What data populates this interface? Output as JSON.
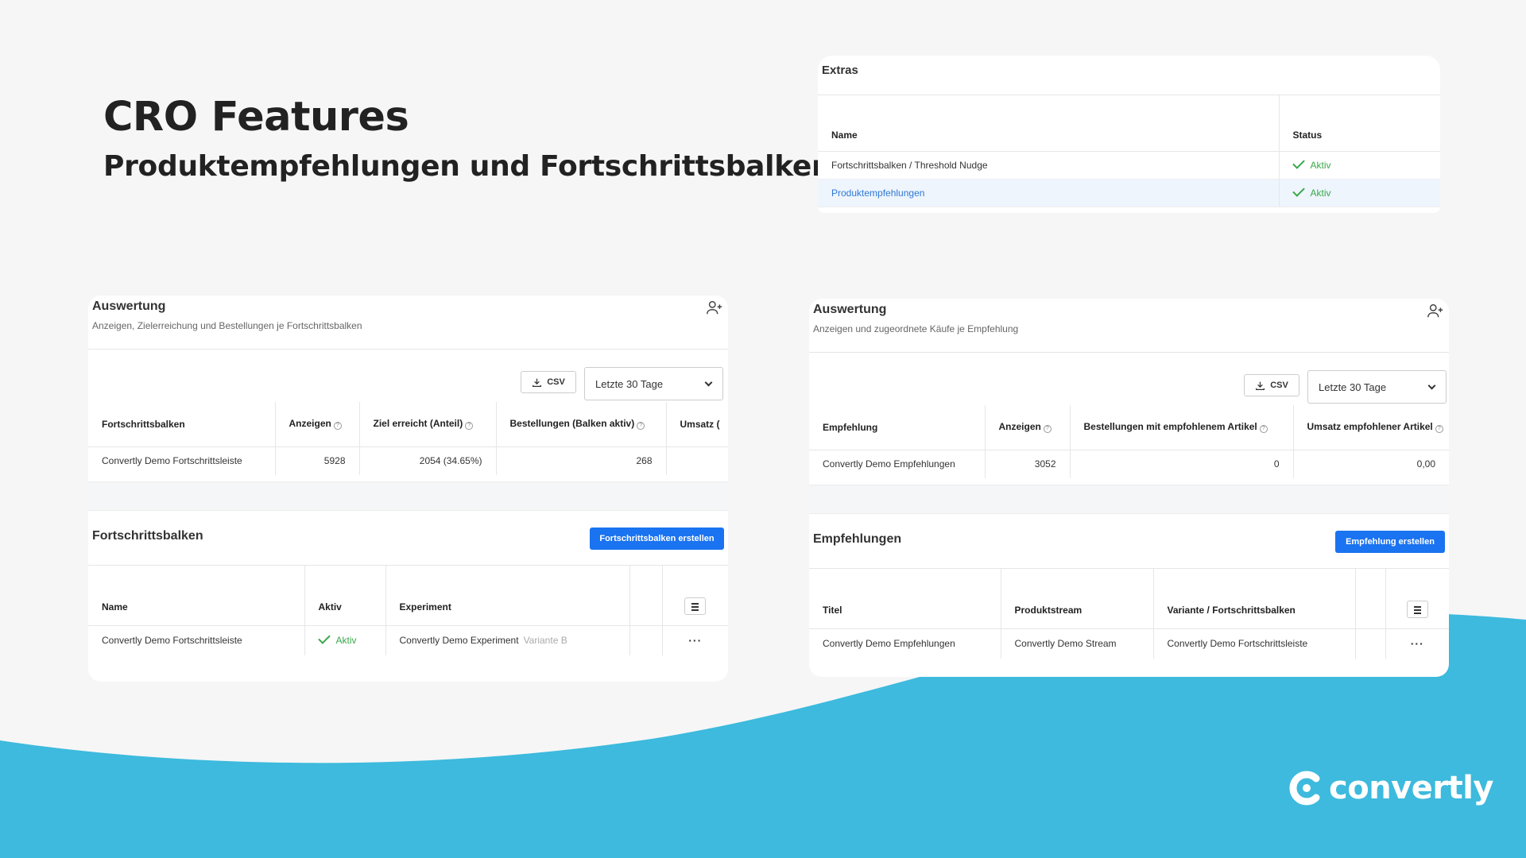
{
  "colors": {
    "accent": "#1a73f0",
    "wave": "#3dbadd",
    "status_active": "#39a84a"
  },
  "hero": {
    "title": "CRO Features",
    "subtitle": "Produktempfehlungen und Fortschrittsbalken"
  },
  "extras": {
    "title": "Extras",
    "columns": [
      "Name",
      "Status"
    ],
    "rows": [
      {
        "name": "Fortschrittsbalken / Threshold Nudge",
        "status": "Aktiv"
      },
      {
        "name": "Produktempfehlungen",
        "status": "Aktiv"
      }
    ]
  },
  "left_panel": {
    "title": "Auswertung",
    "description": "Anzeigen, Zielerreichung und Bestellungen je Fortschrittsbalken",
    "csv_label": "CSV",
    "date_range": "Letzte 30 Tage",
    "stats_columns": [
      "Fortschrittsbalken",
      "Anzeigen",
      "Ziel erreicht (Anteil)",
      "Bestellungen (Balken aktiv)",
      "Umsatz ("
    ],
    "stats_row": {
      "name": "Convertly Demo Fortschrittsleiste",
      "anzeigen": "5928",
      "ziel": "2054 (34.65%)",
      "bestellungen": "268",
      "umsatz": ""
    },
    "section_title": "Fortschrittsbalken",
    "create_button": "Fortschrittsbalken erstellen",
    "list_columns": [
      "Name",
      "Aktiv",
      "Experiment"
    ],
    "list_row": {
      "name": "Convertly Demo Fortschrittsleiste",
      "aktiv": "Aktiv",
      "experiment": "Convertly Demo Experiment",
      "variant": "Variante B",
      "actions": "···"
    }
  },
  "right_panel": {
    "title": "Auswertung",
    "description": "Anzeigen und zugeordnete Käufe je Empfehlung",
    "csv_label": "CSV",
    "date_range": "Letzte 30 Tage",
    "stats_columns": [
      "Empfehlung",
      "Anzeigen",
      "Bestellungen mit empfohlenem Artikel",
      "Umsatz empfohlener Artikel"
    ],
    "stats_row": {
      "name": "Convertly Demo Empfehlungen",
      "anzeigen": "3052",
      "bestellungen": "0",
      "umsatz": "0,00"
    },
    "section_title": "Empfehlungen",
    "create_button": "Empfehlung erstellen",
    "list_columns": [
      "Titel",
      "Produktstream",
      "Variante / Fortschrittsbalken"
    ],
    "list_row": {
      "titel": "Convertly Demo Empfehlungen",
      "stream": "Convertly Demo Stream",
      "variante": "Convertly Demo Fortschrittsleiste",
      "actions": "···"
    }
  },
  "logo": {
    "text": "convertly"
  }
}
